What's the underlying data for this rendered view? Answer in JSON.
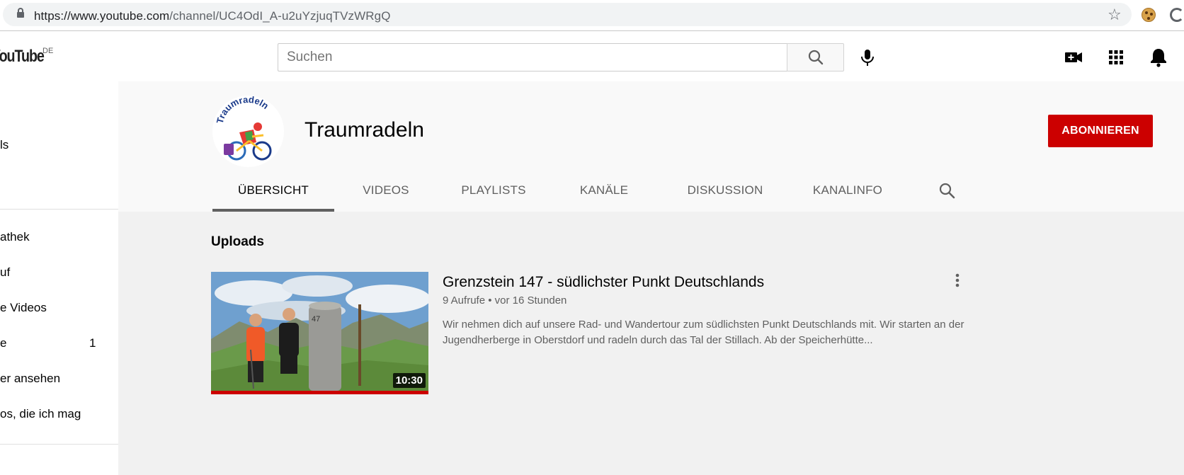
{
  "browser": {
    "url_host": "https://www.youtube.com",
    "url_path": "/channel/UC4OdI_A-u2uYzjuqTVzWRgQ"
  },
  "header": {
    "logo_text": "YouTube",
    "logo_region": "DE",
    "search_placeholder": "Suchen"
  },
  "sidebar": {
    "items": [
      {
        "label": "ls"
      },
      {
        "label": "athek"
      },
      {
        "label": "uf"
      },
      {
        "label": "e Videos"
      },
      {
        "label": "e",
        "count": "1"
      },
      {
        "label": "er ansehen"
      },
      {
        "label": "os, die ich mag"
      }
    ]
  },
  "channel": {
    "name": "Traumradeln",
    "avatar_text": "Traumradeln",
    "subscribe_label": "ABONNIEREN",
    "tabs": [
      {
        "label": "ÜBERSICHT"
      },
      {
        "label": "VIDEOS"
      },
      {
        "label": "PLAYLISTS"
      },
      {
        "label": "KANÄLE"
      },
      {
        "label": "DISKUSSION"
      },
      {
        "label": "KANALINFO"
      }
    ],
    "active_tab": "ÜBERSICHT"
  },
  "uploads": {
    "section_title": "Uploads",
    "video": {
      "title": "Grenzstein 147 - südlichster Punkt Deutschlands",
      "views": "9 Aufrufe",
      "age": "vor 16 Stunden",
      "description": "Wir nehmen dich auf unsere Rad- und Wandertour zum südlichsten Punkt Deutschlands mit. Wir starten an der Jugendherberge in Oberstdorf und radeln durch das Tal der Stillach. Ab der Speicherhütte...",
      "duration": "10:30",
      "stone_number": "47",
      "watched_fraction": 1.0
    }
  },
  "colors": {
    "accent_red": "#cc0000",
    "channel_header_bg": "#f9f9f9",
    "content_bg": "#f1f1f1"
  },
  "icons": [
    "lock-icon",
    "star-icon",
    "cookie-icon",
    "extension-icon",
    "search-icon",
    "mic-icon",
    "video-camera-plus-icon",
    "apps-grid-icon",
    "bell-icon",
    "more-vertical-icon"
  ]
}
